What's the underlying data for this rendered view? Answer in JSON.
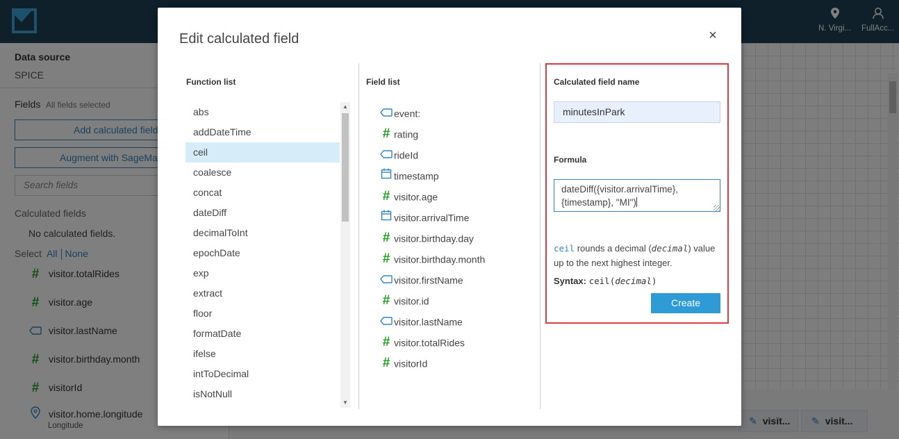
{
  "topbar": {
    "region_label": "N. Virgi...",
    "user_label": "FullAcc..."
  },
  "sidebar": {
    "data_source_title": "Data source",
    "data_source_value": "SPICE",
    "fields_label": "Fields",
    "fields_sub": "All fields selected",
    "add_calc_label": "Add calculated field",
    "augment_label": "Augment with SageMaker",
    "search_placeholder": "Search fields",
    "calc_fields_label": "Calculated fields",
    "no_calc_text": "No calculated fields.",
    "select_label": "Select",
    "select_all": "All",
    "select_none": "None",
    "fields": [
      {
        "label": "visitor.totalRides",
        "type": "number"
      },
      {
        "label": "visitor.age",
        "type": "number"
      },
      {
        "label": "visitor.lastName",
        "type": "string"
      },
      {
        "label": "visitor.birthday.month",
        "type": "number"
      },
      {
        "label": "visitorId",
        "type": "number"
      },
      {
        "label": "visitor.home.longitude",
        "type": "geo"
      }
    ],
    "longitude_sub": "Longitude"
  },
  "canvas": {
    "visual_tabs": [
      "visit...",
      "visit..."
    ]
  },
  "modal": {
    "title": "Edit calculated field",
    "close_symbol": "×",
    "function_list": {
      "header": "Function list",
      "items": [
        "abs",
        "addDateTime",
        "ceil",
        "coalesce",
        "concat",
        "dateDiff",
        "decimalToInt",
        "epochDate",
        "exp",
        "extract",
        "floor",
        "formatDate",
        "ifelse",
        "intToDecimal",
        "isNotNull"
      ],
      "selected": "ceil"
    },
    "field_list": {
      "header": "Field list",
      "items": [
        {
          "label": "event:",
          "type": "string"
        },
        {
          "label": "rating",
          "type": "number"
        },
        {
          "label": "rideId",
          "type": "string"
        },
        {
          "label": "timestamp",
          "type": "date"
        },
        {
          "label": "visitor.age",
          "type": "number"
        },
        {
          "label": "visitor.arrivalTime",
          "type": "date"
        },
        {
          "label": "visitor.birthday.day",
          "type": "number"
        },
        {
          "label": "visitor.birthday.month",
          "type": "number"
        },
        {
          "label": "visitor.firstName",
          "type": "string"
        },
        {
          "label": "visitor.id",
          "type": "number"
        },
        {
          "label": "visitor.lastName",
          "type": "string"
        },
        {
          "label": "visitor.totalRides",
          "type": "number"
        },
        {
          "label": "visitorId",
          "type": "number"
        }
      ]
    },
    "editor": {
      "name_label": "Calculated field name",
      "name_value": "minutesInPark",
      "formula_label": "Formula",
      "formula_line1": "dateDiff({visitor.arrivalTime},",
      "formula_line2": "{timestamp}, \"MI\")",
      "desc_fn": "ceil",
      "desc_text1": " rounds a decimal (",
      "desc_arg": "decimal",
      "desc_text2": ") value up to the next highest integer.",
      "syntax_label": "Syntax:",
      "syntax_fn": "ceil(",
      "syntax_arg": "decimal",
      "syntax_close": ")",
      "create_label": "Create"
    }
  },
  "colors": {
    "topbar": "#1e4055",
    "accent": "#2e86c1",
    "number_icon": "#1fa21f",
    "highlight_box": "#e0393e",
    "selected_row": "#d6ecf8"
  }
}
